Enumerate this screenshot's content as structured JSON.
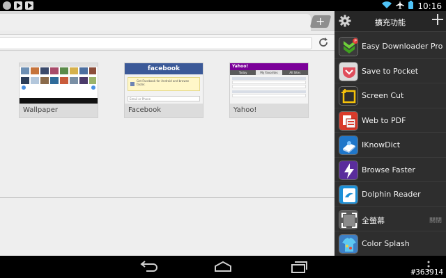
{
  "status_bar": {
    "time": "10:16",
    "left_icons": [
      "android-icon",
      "play-icon",
      "play-icon"
    ],
    "right_icons": [
      "wifi-icon",
      "airplane-icon",
      "battery-icon"
    ]
  },
  "browser": {
    "tab_new_label": "+",
    "speed_dial": [
      {
        "title": "Wallpaper"
      },
      {
        "title": "Facebook",
        "header": "facebook",
        "notice": "Get Facebook for Android and browse faster.",
        "field": "Email or Phone"
      },
      {
        "title": "Yahoo!",
        "logo": "Yahoo!",
        "tabs": [
          "Today",
          "My Favorites",
          "All Sites"
        ]
      }
    ]
  },
  "extensions_panel": {
    "title": "擴充功能",
    "items": [
      {
        "label": "Easy Downloader Pro",
        "icon": "download-arrow-icon",
        "color": "#2b8a1f"
      },
      {
        "label": "Save to Pocket",
        "icon": "pocket-icon",
        "color": "#e04e5c"
      },
      {
        "label": "Screen Cut",
        "icon": "crop-icon",
        "color": "#3a3a3a"
      },
      {
        "label": "Web to PDF",
        "icon": "pdf-icon",
        "color": "#d93b2b"
      },
      {
        "label": "IKnowDict",
        "icon": "dictionary-book-icon",
        "color": "#1f76c9"
      },
      {
        "label": "Browse Faster",
        "icon": "lightning-icon",
        "color": "#5a2d9c"
      },
      {
        "label": "Dolphin Reader",
        "icon": "reader-icon",
        "color": "#1c8fd6"
      },
      {
        "label": "全螢幕",
        "icon": "fullscreen-icon",
        "color": "#555555",
        "status": "關閉"
      },
      {
        "label": "Color Splash",
        "icon": "color-shirt-icon",
        "color": "#3d7fc4"
      }
    ]
  },
  "watermark": "#363914"
}
